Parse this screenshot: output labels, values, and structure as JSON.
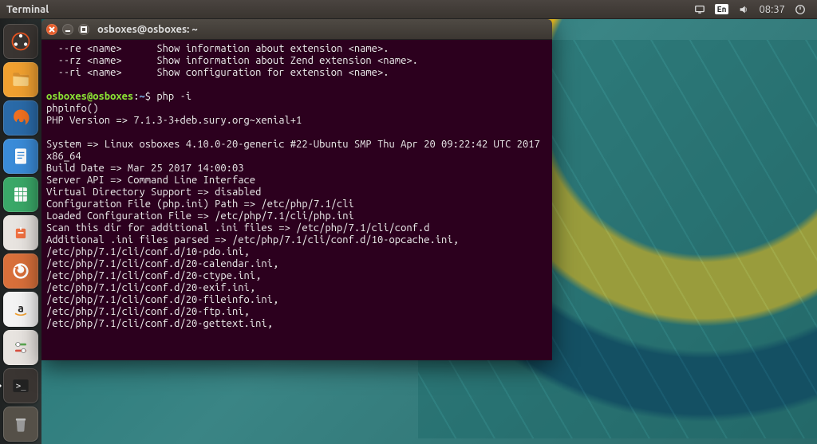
{
  "topbar": {
    "app_title": "Terminal",
    "lang": "En",
    "clock": "08:37"
  },
  "launcher": {
    "items": [
      {
        "name": "dash-icon",
        "bg": "#3a3532"
      },
      {
        "name": "files-icon",
        "bg": "#f0a030"
      },
      {
        "name": "firefox-icon",
        "bg": "#2a6aa8"
      },
      {
        "name": "document-icon",
        "bg": "#3a8bd8"
      },
      {
        "name": "spreadsheet-icon",
        "bg": "#3aa868"
      },
      {
        "name": "software-icon",
        "bg": "#e8e4e0"
      },
      {
        "name": "updater-icon",
        "bg": "#d86f3a"
      },
      {
        "name": "amazon-icon",
        "bg": "#f4f4f4"
      },
      {
        "name": "settings-icon",
        "bg": "#e8e4e0"
      },
      {
        "name": "terminal-icon",
        "bg": "#3a3532",
        "active": true
      },
      {
        "name": "trash-icon",
        "bg": "#555048"
      }
    ]
  },
  "window": {
    "title": "osboxes@osboxes: ~"
  },
  "terminal": {
    "help_lines": [
      "  --re <name>      Show information about extension <name>.",
      "  --rz <name>      Show information about Zend extension <name>.",
      "  --ri <name>      Show configuration for extension <name>."
    ],
    "prompt_user": "osboxes@osboxes",
    "prompt_path": "~",
    "command": "php -i",
    "output_lines": [
      "phpinfo()",
      "PHP Version => 7.1.3-3+deb.sury.org~xenial+1",
      "",
      "System => Linux osboxes 4.10.0-20-generic #22-Ubuntu SMP Thu Apr 20 09:22:42 UTC 2017 x86_64",
      "Build Date => Mar 25 2017 14:00:03",
      "Server API => Command Line Interface",
      "Virtual Directory Support => disabled",
      "Configuration File (php.ini) Path => /etc/php/7.1/cli",
      "Loaded Configuration File => /etc/php/7.1/cli/php.ini",
      "Scan this dir for additional .ini files => /etc/php/7.1/cli/conf.d",
      "Additional .ini files parsed => /etc/php/7.1/cli/conf.d/10-opcache.ini,",
      "/etc/php/7.1/cli/conf.d/10-pdo.ini,",
      "/etc/php/7.1/cli/conf.d/20-calendar.ini,",
      "/etc/php/7.1/cli/conf.d/20-ctype.ini,",
      "/etc/php/7.1/cli/conf.d/20-exif.ini,",
      "/etc/php/7.1/cli/conf.d/20-fileinfo.ini,",
      "/etc/php/7.1/cli/conf.d/20-ftp.ini,",
      "/etc/php/7.1/cli/conf.d/20-gettext.ini,"
    ]
  }
}
